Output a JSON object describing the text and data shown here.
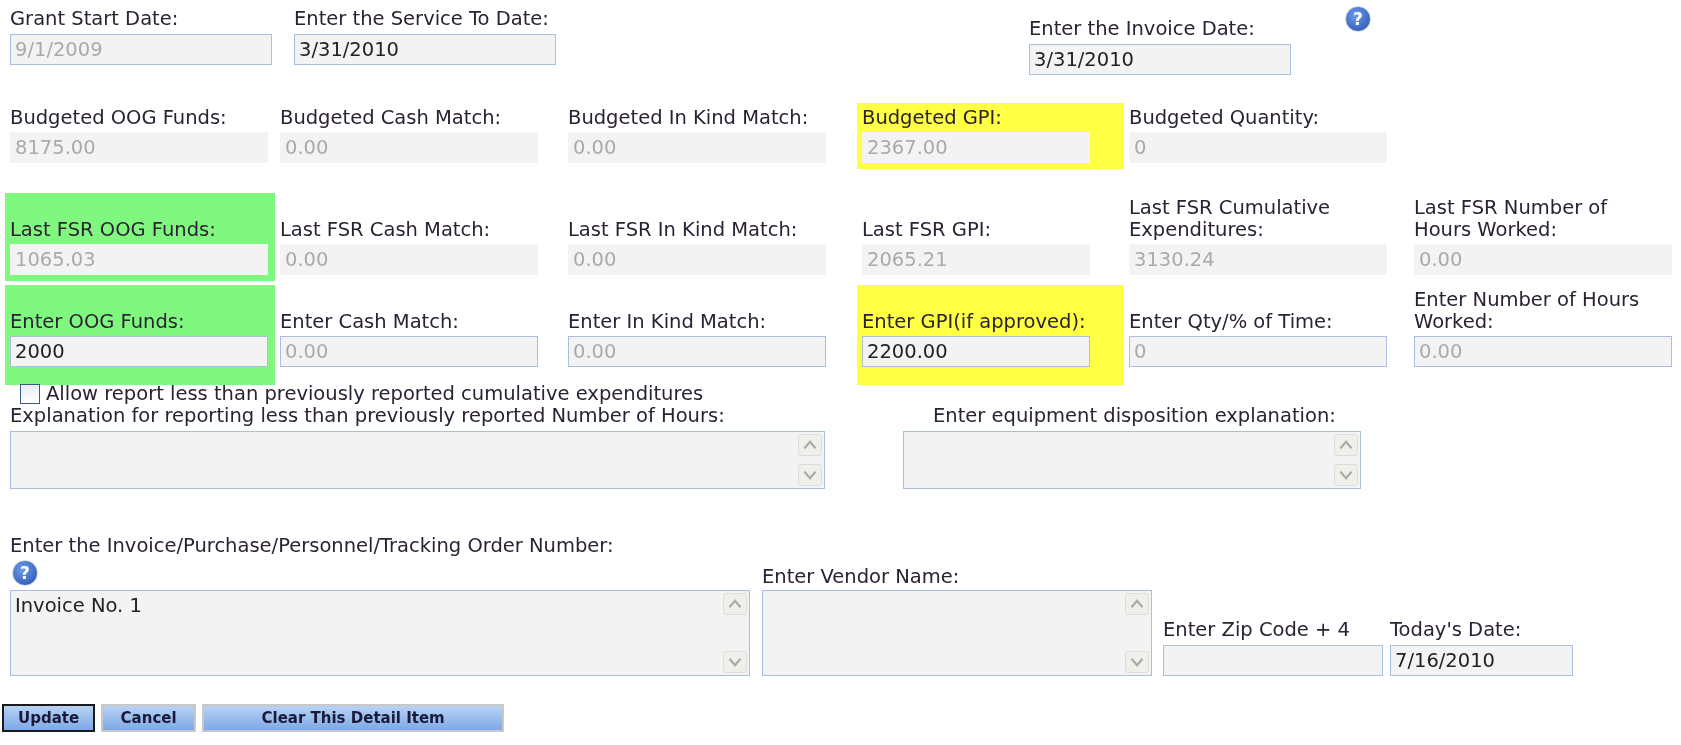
{
  "top_fields": [
    {
      "label": "Grant Start Date:",
      "value": "9/1/2009",
      "disabled": true,
      "kind": "input"
    },
    {
      "label": "Enter the Service To Date:",
      "value": "3/31/2010",
      "disabled": false,
      "kind": "input"
    },
    {
      "label": "Enter the Invoice Date:",
      "value": "3/31/2010",
      "disabled": false,
      "kind": "input"
    }
  ],
  "top_help": "?",
  "grid_rows": [
    [
      {
        "label": "Budgeted OOG Funds:",
        "value": "8175.00",
        "disabled": true,
        "kind": "display"
      },
      {
        "label": "Budgeted Cash Match:",
        "value": "0.00",
        "disabled": true,
        "kind": "display"
      },
      {
        "label": "Budgeted In Kind Match:",
        "value": "0.00",
        "disabled": true,
        "kind": "display"
      },
      {
        "label": "Budgeted GPI:",
        "value": "2367.00",
        "disabled": true,
        "kind": "display",
        "color": "#ffff44"
      },
      {
        "label": "Budgeted Quantity:",
        "value": "0",
        "disabled": true,
        "kind": "display"
      }
    ],
    [
      {
        "label": "Last FSR OOG Funds:",
        "value": "1065.03",
        "disabled": true,
        "kind": "display",
        "color": "#80f880"
      },
      {
        "label": "Last FSR Cash Match:",
        "value": "0.00",
        "disabled": true,
        "kind": "display"
      },
      {
        "label": "Last FSR In Kind Match:",
        "value": "0.00",
        "disabled": true,
        "kind": "display"
      },
      {
        "label": "Last FSR GPI:",
        "value": "2065.21",
        "disabled": true,
        "kind": "display"
      },
      {
        "label": "Last FSR Cumulative Expenditures:",
        "value": "3130.24",
        "disabled": true,
        "kind": "display"
      },
      {
        "label": "Last FSR Number of Hours Worked:",
        "value": "0.00",
        "disabled": true,
        "kind": "display"
      }
    ],
    [
      {
        "label": "Enter OOG Funds:",
        "value": "2000",
        "disabled": false,
        "kind": "input",
        "color": "#80f880"
      },
      {
        "label": "Enter Cash Match:",
        "value": "0.00",
        "disabled": true,
        "kind": "input"
      },
      {
        "label": "Enter In Kind Match:",
        "value": "0.00",
        "disabled": true,
        "kind": "input"
      },
      {
        "label": "Enter GPI(if approved):",
        "value": "2200.00",
        "disabled": false,
        "kind": "input",
        "color": "#ffff44"
      },
      {
        "label": "Enter Qty/% of Time:",
        "value": "0",
        "disabled": true,
        "kind": "input"
      },
      {
        "label": "Enter Number of Hours Worked:",
        "value": "0.00",
        "disabled": true,
        "kind": "input"
      }
    ]
  ],
  "allow_less": {
    "label": "Allow report less than previously reported cumulative expenditures",
    "checked": false
  },
  "explanations": [
    {
      "label": "Explanation for reporting less than previously reported Number of Hours:"
    },
    {
      "label": "Enter equipment disposition explanation:"
    }
  ],
  "order_number": {
    "label": "Enter the Invoice/Purchase/Personnel/Tracking Order Number:",
    "help": "?",
    "value": "Invoice No. 1"
  },
  "vendor": {
    "label": "Enter Vendor Name:"
  },
  "zip": {
    "label": "Enter Zip Code + 4"
  },
  "today": {
    "label": "Today's Date:",
    "value": "7/16/2010"
  },
  "buttons": [
    {
      "label": "Update",
      "default": true
    },
    {
      "label": "Cancel",
      "default": false
    },
    {
      "label": "Clear This Detail Item",
      "default": false
    }
  ]
}
